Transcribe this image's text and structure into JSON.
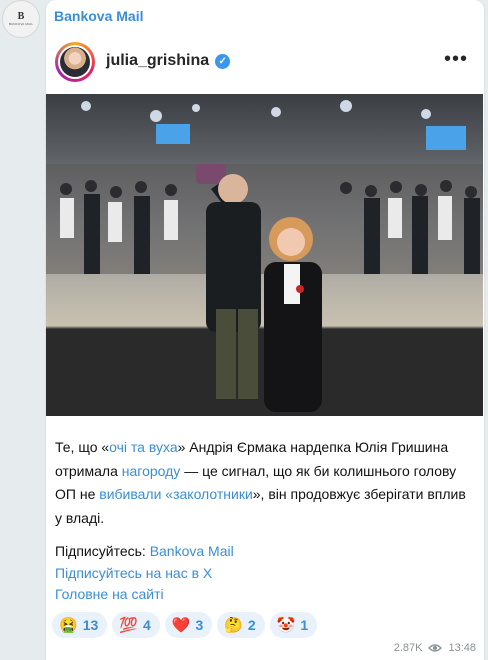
{
  "channel": {
    "avatar_letter": "B",
    "avatar_caption": "BANKOVA MAIL",
    "name": "Bankova Mail"
  },
  "embed": {
    "username": "julia_grishina",
    "verified_icon": "check",
    "more_icon": "•••"
  },
  "post": {
    "p1": "Те, що «",
    "link1": "очі та вуха",
    "p2": "» Андрія Єрмака нардепка Юлія Гришина отримала ",
    "link2": "нагороду",
    "p3": " — це сигнал, що як би колишнього голову ОП не ",
    "link3": "вибивали",
    "p4": " ",
    "link4": "«заколотники",
    "p5": "», він продовжує зберігати вплив у владі."
  },
  "footer": {
    "subscribe_label": "Підписуйтесь: ",
    "subscribe_link": "Bankova Mail",
    "x_link": "Підписуйтесь на нас в X",
    "site_link": "Головне на сайті"
  },
  "reactions": [
    {
      "emoji": "🤮",
      "count": "13"
    },
    {
      "emoji": "💯",
      "count": "4"
    },
    {
      "emoji": "❤️",
      "count": "3"
    },
    {
      "emoji": "🤔",
      "count": "2"
    },
    {
      "emoji": "🤡",
      "count": "1"
    }
  ],
  "meta": {
    "views": "2.87K",
    "time": "13:48"
  },
  "colors": {
    "accent": "#3a8ed6",
    "background": "#e6ebee"
  }
}
